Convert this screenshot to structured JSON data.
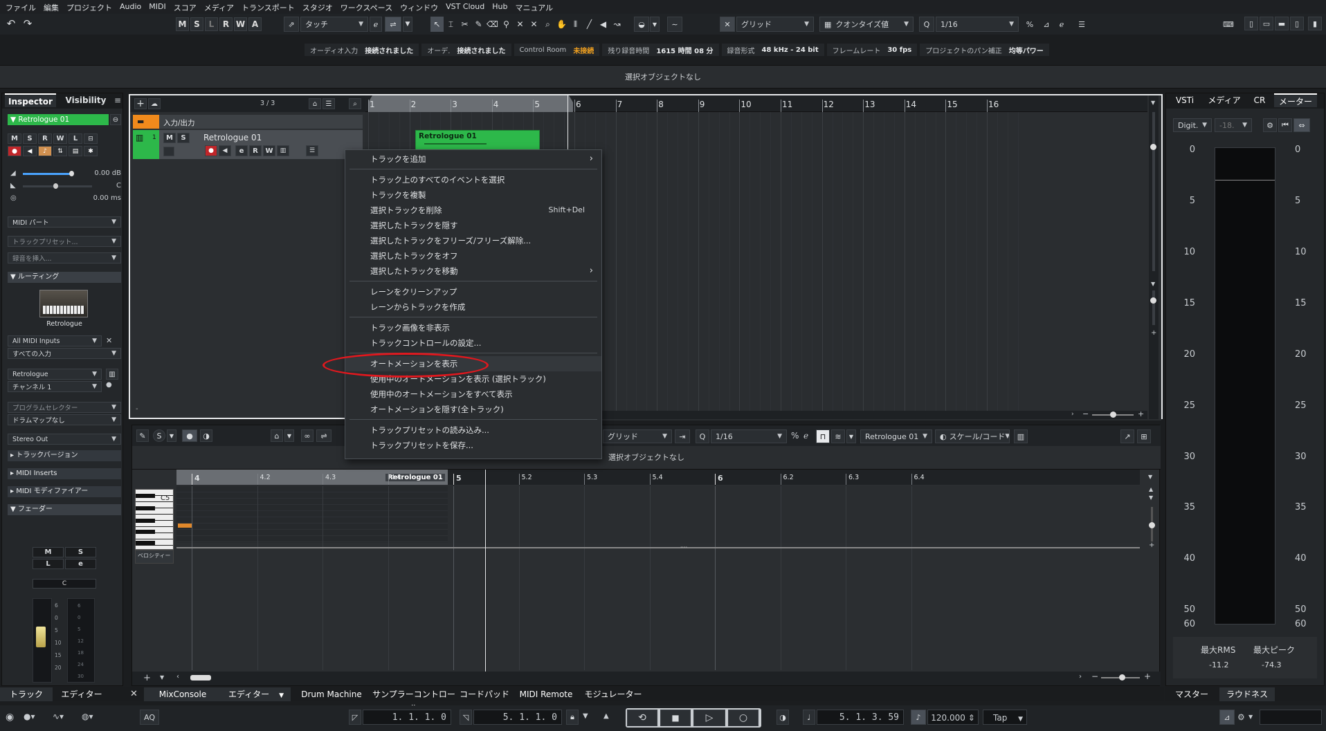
{
  "menubar": [
    "ファイル",
    "編集",
    "プロジェクト",
    "Audio",
    "MIDI",
    "スコア",
    "メディア",
    "トランスポート",
    "スタジオ",
    "ワークスペース",
    "ウィンドウ",
    "VST Cloud",
    "Hub",
    "マニュアル"
  ],
  "toolbar": {
    "state_buttons": [
      "M",
      "S",
      "L",
      "R",
      "W",
      "A"
    ],
    "automation_mode": "タッチ",
    "snap_type": "グリッド",
    "quantize_type": "クオンタイズ値",
    "quantize_value": "1/16"
  },
  "statusbar": {
    "audio_input_label": "オーディオ入力",
    "audio_input_value": "接続されました",
    "audio_out_label": "オーデ.",
    "audio_out_value": "接続されました",
    "control_room_label": "Control Room",
    "control_room_value": "未接続",
    "rec_time_label": "残り録音時間",
    "rec_time_value": "1615 時間 08 分",
    "rec_format_label": "録音形式",
    "rec_format_value": "48 kHz - 24 bit",
    "frame_rate_label": "フレームレート",
    "frame_rate_value": "30 fps",
    "pan_label": "プロジェクトのパン補正",
    "pan_value": "均等パワー"
  },
  "info_line": "選択オブジェクトなし",
  "inspector": {
    "tabs": [
      "Inspector",
      "Visibility"
    ],
    "track_name": "Retrologue 01",
    "row_buttons": [
      "M",
      "S",
      "R",
      "W",
      "L"
    ],
    "volume": "0.00 dB",
    "pan": "C",
    "delay": "0.00 ms",
    "midi_part": "MIDI パート",
    "track_preset": "トラックプリセット...",
    "insert_placeholder": "録音を挿入...",
    "routing_label": "ルーティング",
    "instrument_name": "Retrologue",
    "midi_input": "All MIDI Inputs",
    "input_all": "すべての入力",
    "output": "Retrologue",
    "channel": "チャンネル 1",
    "program": "プログラムセレクター",
    "drum_map": "ドラムマップなし",
    "stereo_out": "Stereo Out",
    "sections": [
      "トラックバージョン",
      "MIDI Inserts",
      "MIDI モディファイアー",
      "フェーダー"
    ],
    "fader_buttons": [
      "M",
      "S",
      "L",
      "e"
    ],
    "fader_pan": "C",
    "fader_scale": [
      "6",
      "0",
      "5",
      "10",
      "15",
      "20"
    ],
    "fader_scale2": [
      "6",
      "0",
      "5",
      "12",
      "18",
      "24",
      "30"
    ]
  },
  "tracklist": {
    "counter": "3 / 3",
    "folder_name": "入力/出力",
    "track_number": "1",
    "track_name": "Retrologue 01",
    "track_buttons": [
      "M",
      "S"
    ],
    "track_buttons2": [
      "e",
      "R",
      "W"
    ]
  },
  "ruler": [
    "1",
    "2",
    "3",
    "4",
    "5",
    "6",
    "7",
    "8",
    "9",
    "10",
    "11",
    "12",
    "13",
    "14",
    "15",
    "16"
  ],
  "event_name": "Retrologue 01",
  "context_menu": {
    "items": [
      {
        "label": "トラックを追加",
        "submenu": true
      },
      {
        "sep": true
      },
      {
        "label": "トラック上のすべてのイベントを選択"
      },
      {
        "label": "トラックを複製"
      },
      {
        "label": "選択トラックを削除",
        "shortcut": "Shift+Del"
      },
      {
        "label": "選択したトラックを隠す"
      },
      {
        "label": "選択したトラックをフリーズ/フリーズ解除..."
      },
      {
        "label": "選択したトラックをオフ"
      },
      {
        "label": "選択したトラックを移動",
        "submenu": true
      },
      {
        "sep": true
      },
      {
        "label": "レーンをクリーンアップ"
      },
      {
        "label": "レーンからトラックを作成"
      },
      {
        "sep": true
      },
      {
        "label": "トラック画像を非表示"
      },
      {
        "label": "トラックコントロールの設定..."
      },
      {
        "sep": true
      },
      {
        "label": "オートメーションを表示",
        "highlight": true
      },
      {
        "label": "使用中のオートメーションを表示 (選択トラック)"
      },
      {
        "label": "使用中のオートメーションをすべて表示"
      },
      {
        "label": "オートメーションを隠す(全トラック)"
      },
      {
        "sep": true
      },
      {
        "label": "トラックプリセットの読み込み..."
      },
      {
        "label": "トラックプリセットを保存..."
      }
    ]
  },
  "editor": {
    "snap": "グリッド",
    "quantize": "1/16",
    "track": "Retrologue 01",
    "scale": "スケール/コード",
    "info": "選択オブジェクトなし",
    "ruler": [
      "4",
      "4.2",
      "4.3",
      "4.4",
      "5",
      "5.2",
      "5.3",
      "5.4",
      "6",
      "6.2",
      "6.3",
      "6.4"
    ],
    "part_label": "Retrologue 01",
    "note_label": "C5",
    "velocity_label": "ベロシティー"
  },
  "right_zone": {
    "tabs": [
      "VSTi",
      "メディア",
      "CR",
      "メーター"
    ],
    "meter_mode": "Digit.",
    "meter_value": "-18.",
    "scale": [
      "0",
      "5",
      "10",
      "15",
      "20",
      "25",
      "30",
      "35",
      "40",
      "50",
      "60"
    ],
    "rms_label": "最大RMS",
    "rms_value": "-11.2",
    "peak_label": "最大ピーク",
    "peak_value": "-74.3",
    "bottom_tabs": [
      "マスター",
      "ラウドネス"
    ]
  },
  "bottom_tabs_left": [
    "トラック",
    "エディター"
  ],
  "bottom_tabs_main": [
    "MixConsole",
    "エディター",
    "Drum Machine",
    "サンプラーコントロール",
    "コードパッド",
    "MIDI Remote",
    "モジュレーター"
  ],
  "transport": {
    "aq": "AQ",
    "left_locator": "1. 1. 1.  0",
    "right_locator": "5. 1. 1.  0",
    "position": "5. 1. 3. 59",
    "tempo": "120.000",
    "tap": "Tap"
  }
}
